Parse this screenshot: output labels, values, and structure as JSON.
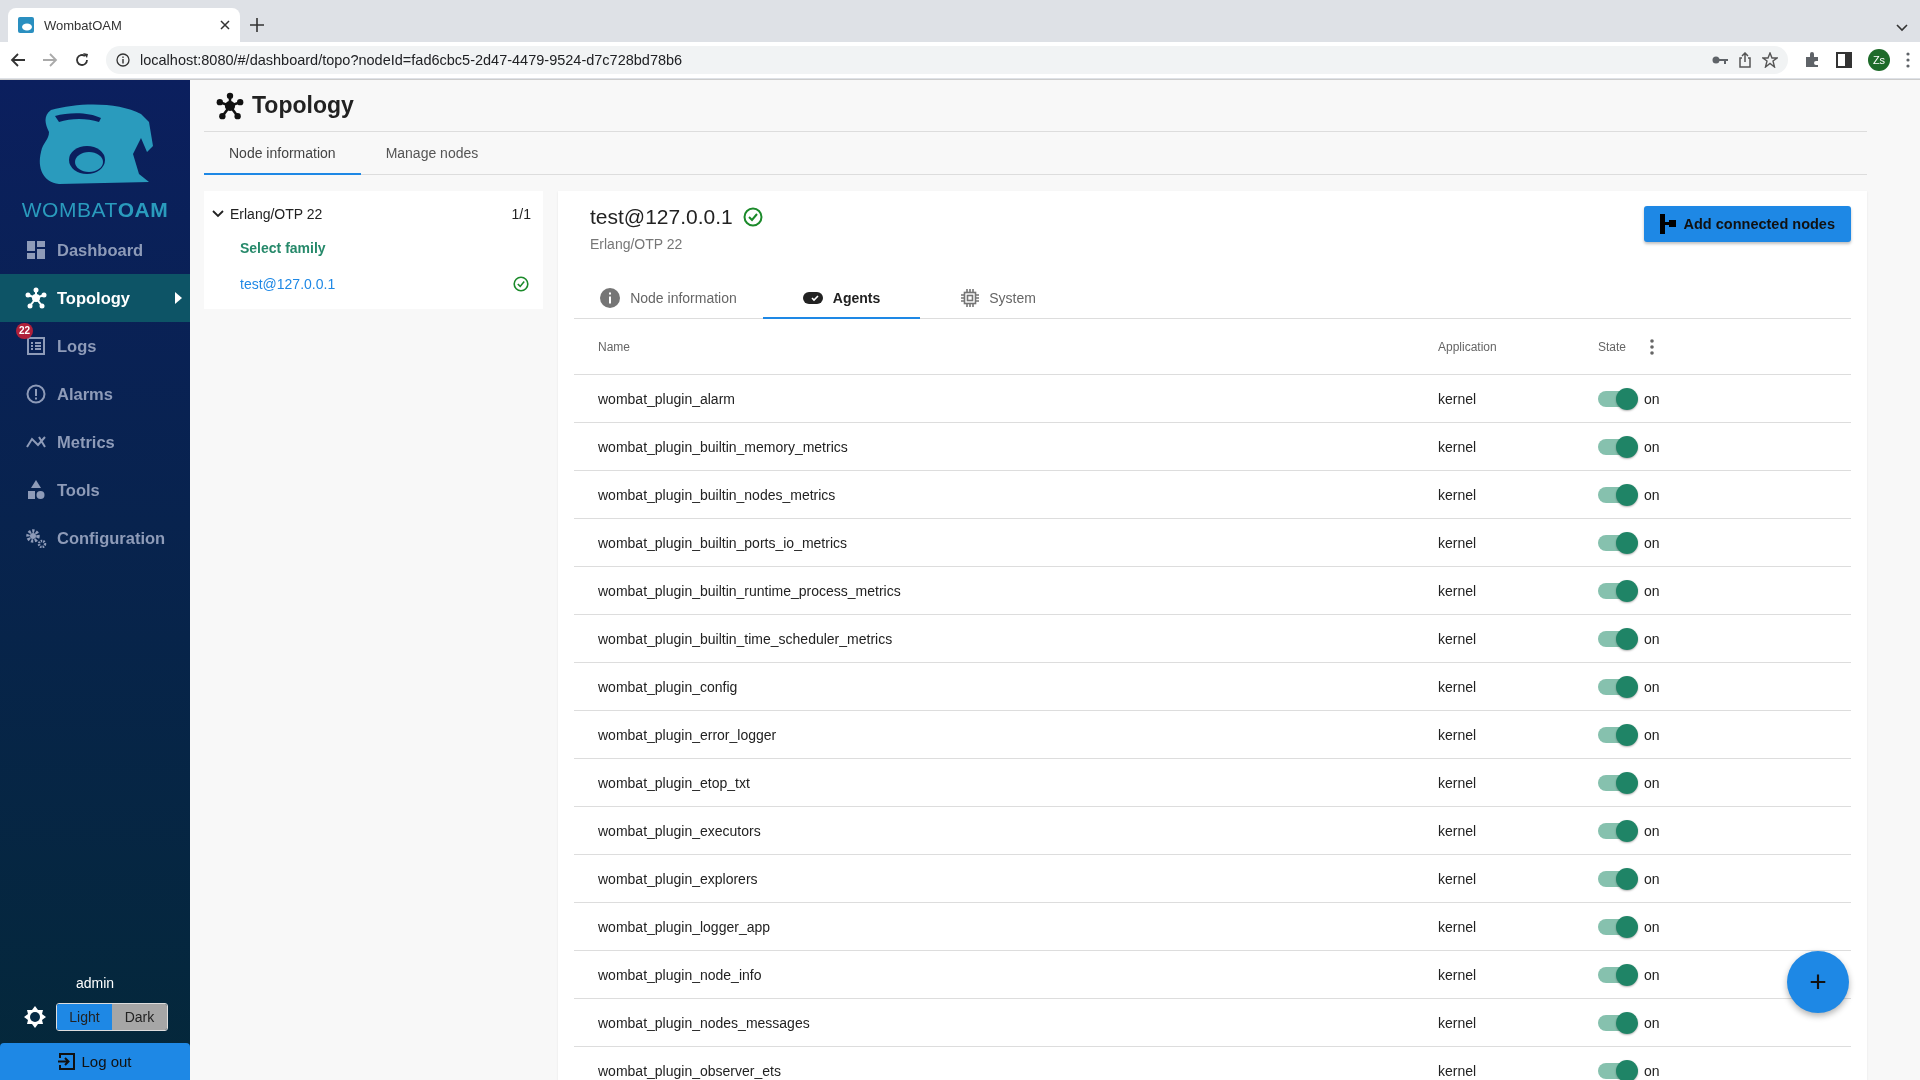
{
  "browser": {
    "tab_title": "WombatOAM",
    "url": "localhost:8080/#/dashboard/topo?nodeId=fad6cbc5-2d47-4479-9524-d7c728bd78b6",
    "profile": "Zs"
  },
  "sidebar": {
    "logo": "WOMBAT**OAM**",
    "items": [
      {
        "label": "Dashboard",
        "selected": false
      },
      {
        "label": "Topology",
        "selected": true
      },
      {
        "label": "Logs",
        "selected": false,
        "badge": "22"
      },
      {
        "label": "Alarms",
        "selected": false
      },
      {
        "label": "Metrics",
        "selected": false
      },
      {
        "label": "Tools",
        "selected": false
      },
      {
        "label": "Configuration",
        "selected": false
      }
    ],
    "user": "admin",
    "theme": [
      {
        "label": "Light",
        "selected": true
      },
      {
        "label": "Dark",
        "selected": false
      }
    ],
    "logout": "Log out"
  },
  "page": {
    "title": "Topology",
    "tabs": [
      {
        "label": "Node information",
        "selected": true
      },
      {
        "label": "Manage nodes",
        "selected": false
      }
    ]
  },
  "tree": {
    "family": "Erlang/OTP 22",
    "count": "1/1",
    "expanded": true,
    "select_family": "Select family",
    "nodes": [
      {
        "label": "test@127.0.0.1",
        "online": true
      }
    ]
  },
  "node": {
    "name": "test@127.0.0.1",
    "online": true,
    "subtitle": "Erlang/OTP 22",
    "add_button": "Add connected nodes",
    "tabs": [
      {
        "label": "Node information",
        "selected": false
      },
      {
        "label": "Agents",
        "selected": true
      },
      {
        "label": "System",
        "selected": false
      }
    ]
  },
  "table": {
    "columns": [
      "Name",
      "Application",
      "State"
    ],
    "rows": [
      {
        "name": "wombat_plugin_alarm",
        "application": "kernel",
        "on": true,
        "state": "on"
      },
      {
        "name": "wombat_plugin_builtin_memory_metrics",
        "application": "kernel",
        "on": true,
        "state": "on"
      },
      {
        "name": "wombat_plugin_builtin_nodes_metrics",
        "application": "kernel",
        "on": true,
        "state": "on"
      },
      {
        "name": "wombat_plugin_builtin_ports_io_metrics",
        "application": "kernel",
        "on": true,
        "state": "on"
      },
      {
        "name": "wombat_plugin_builtin_runtime_process_metrics",
        "application": "kernel",
        "on": true,
        "state": "on"
      },
      {
        "name": "wombat_plugin_builtin_time_scheduler_metrics",
        "application": "kernel",
        "on": true,
        "state": "on"
      },
      {
        "name": "wombat_plugin_config",
        "application": "kernel",
        "on": true,
        "state": "on"
      },
      {
        "name": "wombat_plugin_error_logger",
        "application": "kernel",
        "on": true,
        "state": "on"
      },
      {
        "name": "wombat_plugin_etop_txt",
        "application": "kernel",
        "on": true,
        "state": "on"
      },
      {
        "name": "wombat_plugin_executors",
        "application": "kernel",
        "on": true,
        "state": "on"
      },
      {
        "name": "wombat_plugin_explorers",
        "application": "kernel",
        "on": true,
        "state": "on"
      },
      {
        "name": "wombat_plugin_logger_app",
        "application": "kernel",
        "on": true,
        "state": "on"
      },
      {
        "name": "wombat_plugin_node_info",
        "application": "kernel",
        "on": true,
        "state": "on"
      },
      {
        "name": "wombat_plugin_nodes_messages",
        "application": "kernel",
        "on": true,
        "state": "on"
      },
      {
        "name": "wombat_plugin_observer_ets",
        "application": "kernel",
        "on": true,
        "state": "on"
      }
    ]
  },
  "fab": "+"
}
